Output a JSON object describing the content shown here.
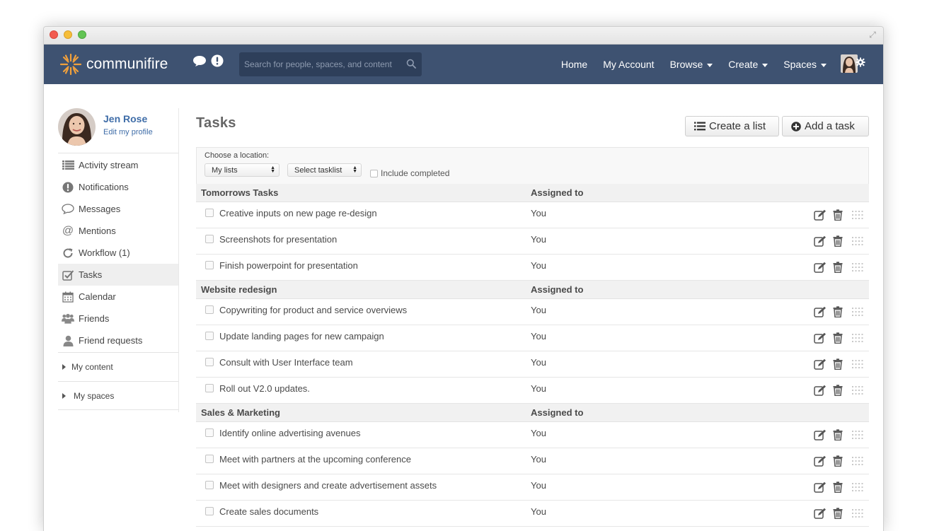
{
  "app": {
    "brand": "communifire",
    "logo_color": "#f0a03c"
  },
  "header": {
    "search_placeholder": "Search for people, spaces, and content",
    "nav": [
      {
        "label": "Home",
        "dropdown": false
      },
      {
        "label": "My Account",
        "dropdown": false
      },
      {
        "label": "Browse",
        "dropdown": true
      },
      {
        "label": "Create",
        "dropdown": true
      },
      {
        "label": "Spaces",
        "dropdown": true
      }
    ],
    "bg_color": "#3e5271"
  },
  "profile": {
    "name": "Jen Rose",
    "edit_label": "Edit my profile"
  },
  "sidebar": {
    "items": [
      {
        "label": "Activity stream",
        "icon": "list-icon"
      },
      {
        "label": "Notifications",
        "icon": "exclamation-icon"
      },
      {
        "label": "Messages",
        "icon": "speech-bubble-icon"
      },
      {
        "label": "Mentions",
        "icon": "at-icon"
      },
      {
        "label": "Workflow (1)",
        "icon": "refresh-icon"
      },
      {
        "label": "Tasks",
        "icon": "checkbox-icon",
        "active": true
      },
      {
        "label": "Calendar",
        "icon": "calendar-icon"
      },
      {
        "label": "Friends",
        "icon": "group-icon"
      },
      {
        "label": "Friend requests",
        "icon": "user-icon"
      }
    ],
    "groups": [
      "My content",
      "My spaces"
    ]
  },
  "main": {
    "title": "Tasks",
    "create_list_label": "Create a list",
    "add_task_label": "Add a task",
    "filter": {
      "label": "Choose a location:",
      "list_value": "My lists",
      "tasklist_value": "Select tasklist",
      "include_completed_label": "Include completed"
    },
    "assigned_header": "Assigned to",
    "groups": [
      {
        "name": "Tomorrows Tasks",
        "tasks": [
          {
            "text": "Creative inputs on new page re-design",
            "assigned": "You"
          },
          {
            "text": "Screenshots for presentation",
            "assigned": "You"
          },
          {
            "text": "Finish powerpoint for presentation",
            "assigned": "You"
          }
        ]
      },
      {
        "name": "Website redesign",
        "tasks": [
          {
            "text": "Copywriting for product and service overviews",
            "assigned": "You"
          },
          {
            "text": "Update landing pages for new campaign",
            "assigned": "You"
          },
          {
            "text": "Consult with User Interface team",
            "assigned": "You"
          },
          {
            "text": "Roll out V2.0 updates.",
            "assigned": "You"
          }
        ]
      },
      {
        "name": "Sales & Marketing",
        "tasks": [
          {
            "text": "Identify online advertising avenues",
            "assigned": "You"
          },
          {
            "text": "Meet with partners at the upcoming conference",
            "assigned": "You"
          },
          {
            "text": "Meet with designers and create advertisement assets",
            "assigned": "You"
          },
          {
            "text": "Create sales documents",
            "assigned": "You"
          }
        ]
      }
    ]
  }
}
